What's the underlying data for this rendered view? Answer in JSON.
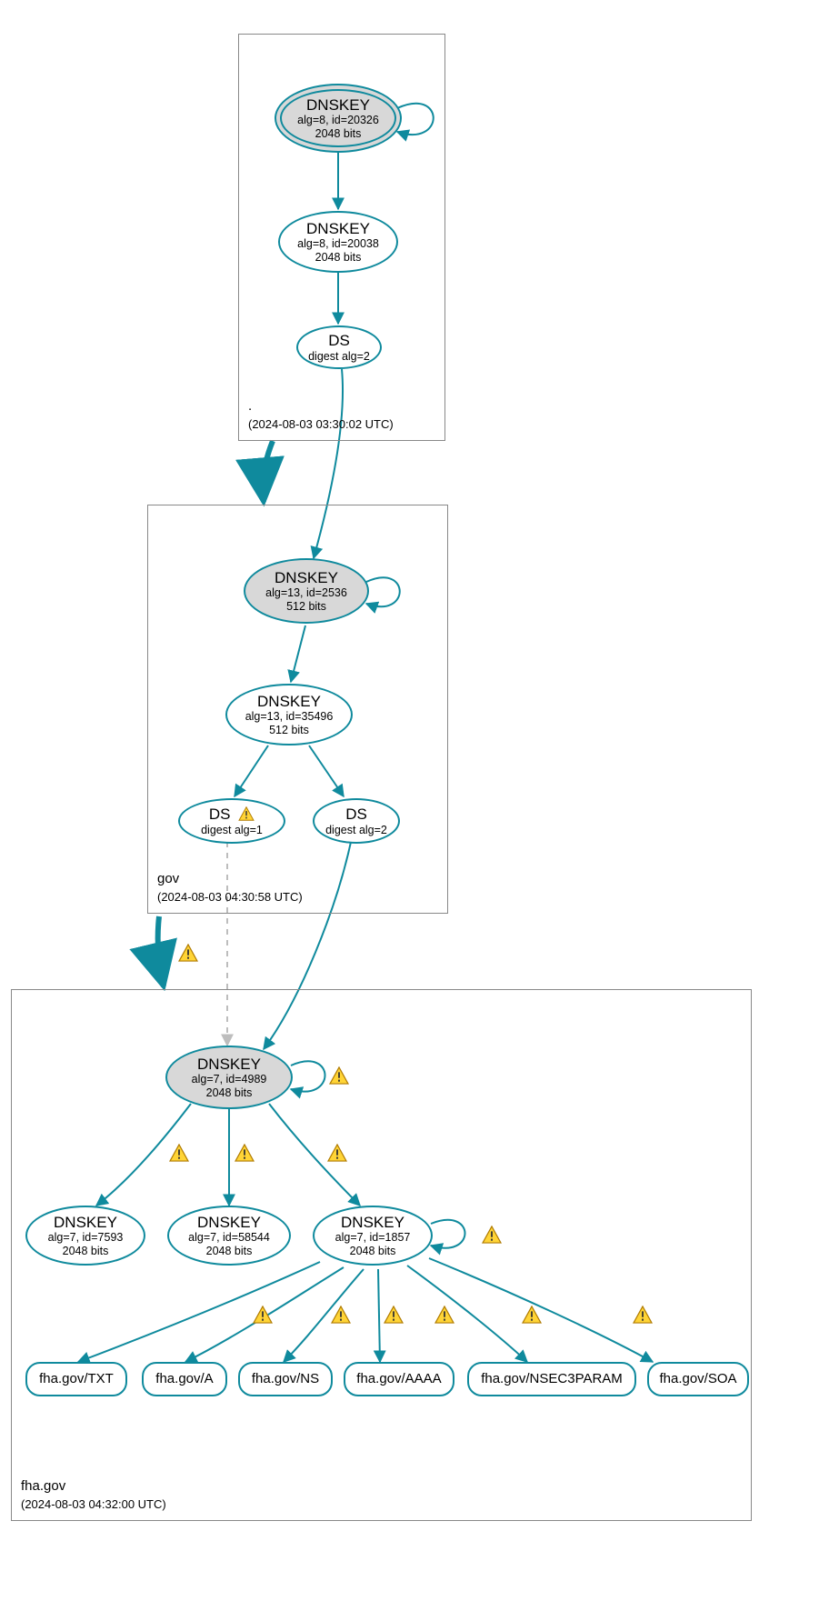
{
  "colors": {
    "teal": "#0f8a9d",
    "gray_fill": "#d8d8d8",
    "gray_edge": "#bdbdbd",
    "warn_yellow": "#ffcc00",
    "warn_stroke": "#996600"
  },
  "zones": {
    "root": {
      "name": ".",
      "ts": "(2024-08-03 03:30:02 UTC)"
    },
    "gov": {
      "name": "gov",
      "ts": "(2024-08-03 04:30:58 UTC)"
    },
    "fha": {
      "name": "fha.gov",
      "ts": "(2024-08-03 04:32:00 UTC)"
    }
  },
  "nodes": {
    "root_ksk": {
      "title": "DNSKEY",
      "l1": "alg=8, id=20326",
      "l2": "2048 bits"
    },
    "root_zsk": {
      "title": "DNSKEY",
      "l1": "alg=8, id=20038",
      "l2": "2048 bits"
    },
    "root_ds": {
      "title": "DS",
      "l1": "digest alg=2"
    },
    "gov_ksk": {
      "title": "DNSKEY",
      "l1": "alg=13, id=2536",
      "l2": "512 bits"
    },
    "gov_zsk": {
      "title": "DNSKEY",
      "l1": "alg=13, id=35496",
      "l2": "512 bits"
    },
    "gov_ds1": {
      "title": "DS",
      "l1": "digest alg=1"
    },
    "gov_ds2": {
      "title": "DS",
      "l1": "digest alg=2"
    },
    "fha_ksk": {
      "title": "DNSKEY",
      "l1": "alg=7, id=4989",
      "l2": "2048 bits"
    },
    "fha_k1": {
      "title": "DNSKEY",
      "l1": "alg=7, id=7593",
      "l2": "2048 bits"
    },
    "fha_k2": {
      "title": "DNSKEY",
      "l1": "alg=7, id=58544",
      "l2": "2048 bits"
    },
    "fha_k3": {
      "title": "DNSKEY",
      "l1": "alg=7, id=1857",
      "l2": "2048 bits"
    },
    "rr_txt": {
      "label": "fha.gov/TXT"
    },
    "rr_a": {
      "label": "fha.gov/A"
    },
    "rr_ns": {
      "label": "fha.gov/NS"
    },
    "rr_aaaa": {
      "label": "fha.gov/AAAA"
    },
    "rr_nsec": {
      "label": "fha.gov/NSEC3PARAM"
    },
    "rr_soa": {
      "label": "fha.gov/SOA"
    }
  },
  "icons": {
    "warning": "warning-icon"
  }
}
